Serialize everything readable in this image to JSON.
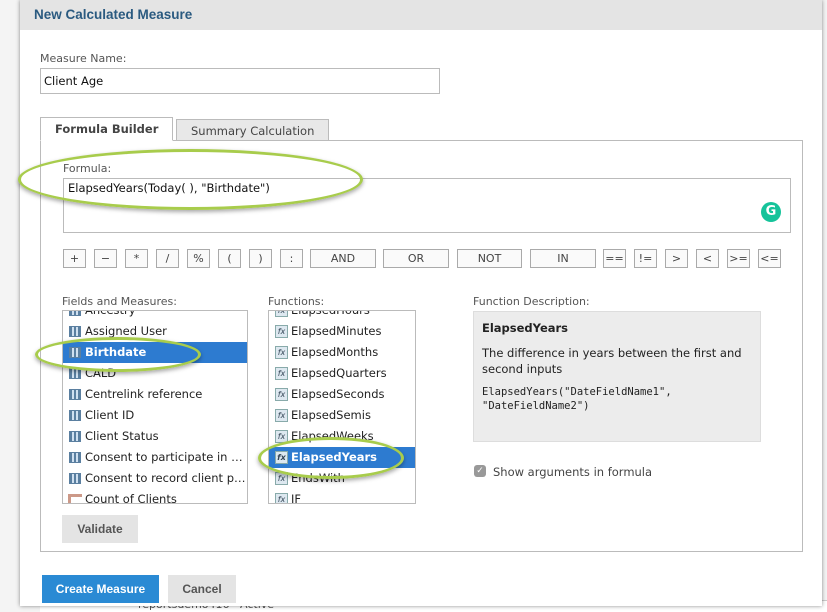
{
  "dialog": {
    "title": "New Calculated Measure"
  },
  "measure_name": {
    "label": "Measure Name:",
    "value": "Client Age"
  },
  "tabs": [
    {
      "label": "Formula Builder",
      "active": true
    },
    {
      "label": "Summary Calculation",
      "active": false
    }
  ],
  "formula": {
    "label": "Formula:",
    "value": "ElapsedYears(Today( ), \"Birthdate\")",
    "grammarly_icon": "G"
  },
  "operators": [
    "+",
    "−",
    "*",
    "/",
    "%",
    "(",
    ")",
    ":",
    "AND",
    "OR",
    "NOT",
    "IN",
    "==",
    "!=",
    ">",
    "<",
    ">=",
    "<="
  ],
  "fields": {
    "label": "Fields and Measures:",
    "items": [
      {
        "label": "Ancestry",
        "icon": "field-icon"
      },
      {
        "label": "Assigned User",
        "icon": "field-icon"
      },
      {
        "label": "Birthdate",
        "icon": "field-icon",
        "selected": true
      },
      {
        "label": "CALD",
        "icon": "field-icon"
      },
      {
        "label": "Centrelink reference",
        "icon": "field-icon"
      },
      {
        "label": "Client ID",
        "icon": "field-icon"
      },
      {
        "label": "Client Status",
        "icon": "field-icon"
      },
      {
        "label": "Consent to participate in client survey",
        "icon": "field-icon"
      },
      {
        "label": "Consent to record client personal details",
        "icon": "field-icon"
      },
      {
        "label": "Count of Clients",
        "icon": "measure-icon"
      }
    ]
  },
  "functions": {
    "label": "Functions:",
    "items": [
      {
        "label": "ElapsedHours"
      },
      {
        "label": "ElapsedMinutes"
      },
      {
        "label": "ElapsedMonths"
      },
      {
        "label": "ElapsedQuarters"
      },
      {
        "label": "ElapsedSeconds"
      },
      {
        "label": "ElapsedSemis"
      },
      {
        "label": "ElapsedWeeks"
      },
      {
        "label": "ElapsedYears",
        "selected": true
      },
      {
        "label": "EndsWith"
      },
      {
        "label": "IF"
      }
    ]
  },
  "description": {
    "label": "Function Description:",
    "name": "ElapsedYears",
    "text": "The difference in years between the first and second inputs",
    "syntax": "ElapsedYears(\"DateFieldName1\", \"DateFieldName2\")"
  },
  "show_args": {
    "label": "Show arguments in formula",
    "checked": true
  },
  "buttons": {
    "validate": "Validate",
    "create": "Create Measure",
    "cancel": "Cancel"
  },
  "background": {
    "row": [
      "reportsdemo416",
      "Active"
    ]
  },
  "colors": {
    "accent": "#2a8ad4",
    "selection": "#2d7bd0",
    "highlight_ellipse": "#a8cc4c"
  }
}
